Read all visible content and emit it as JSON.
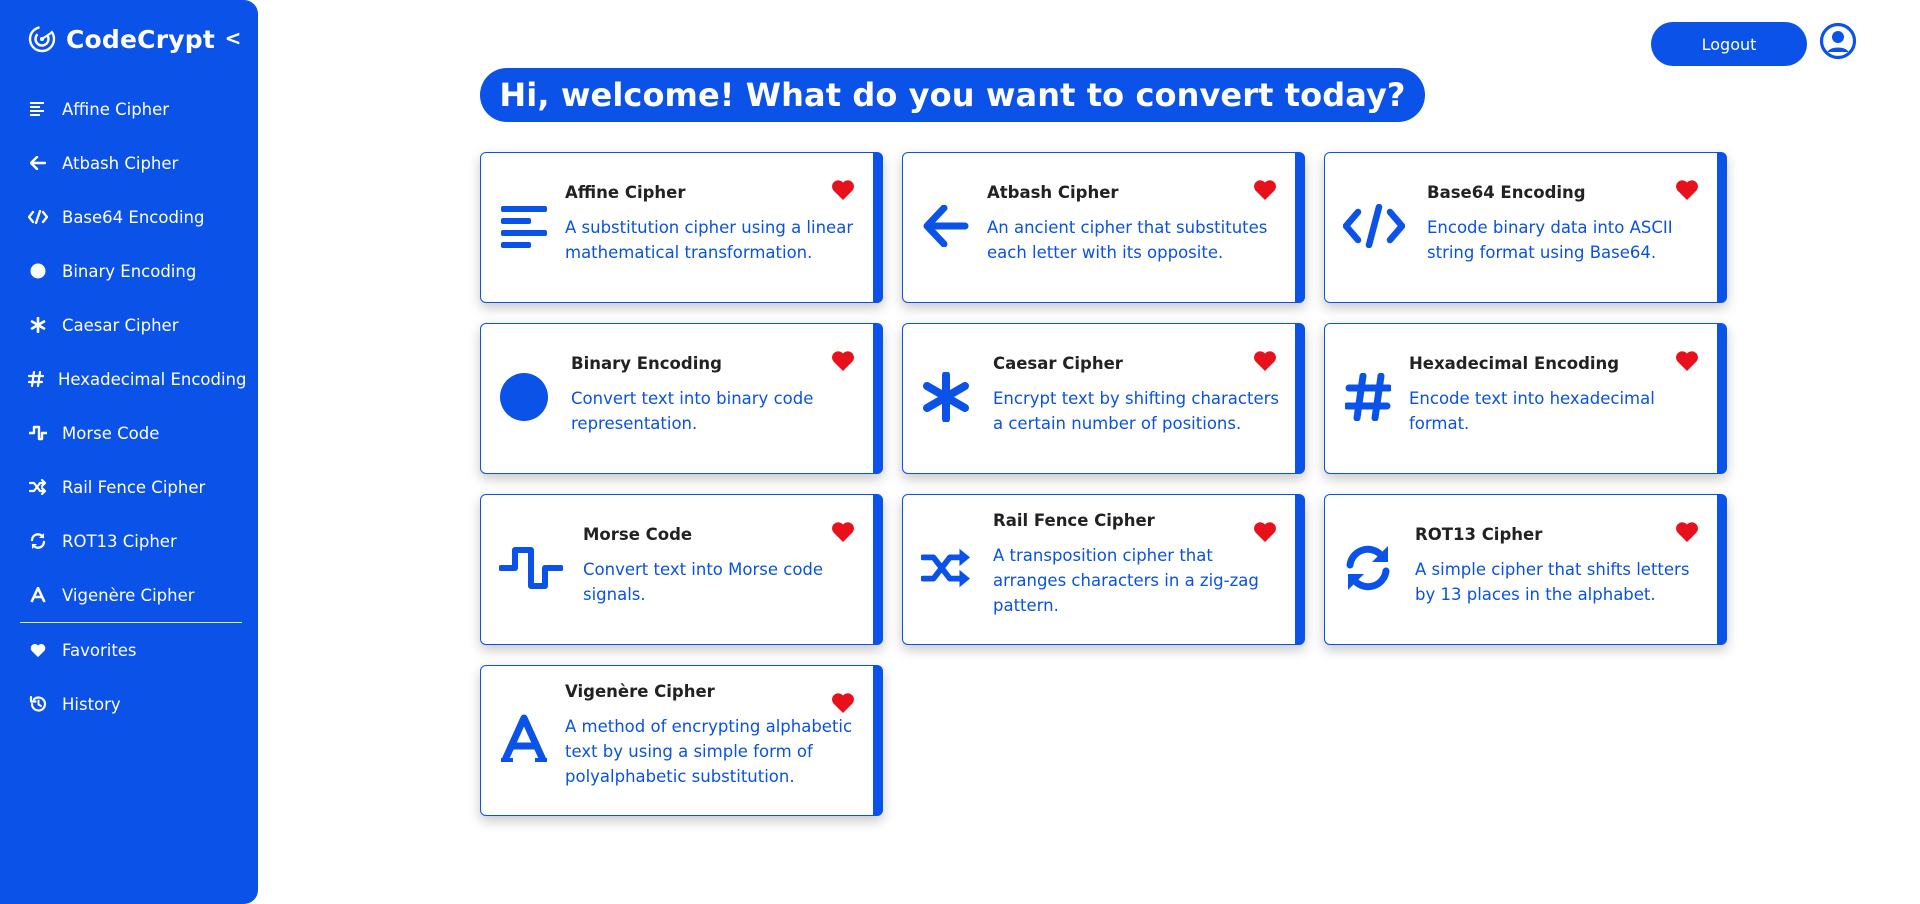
{
  "app": {
    "name": "CodeCrypt",
    "collapse_label": "<"
  },
  "colors": {
    "primary": "#0a52e8",
    "favorite": "#e8101a",
    "title_text": "#222222"
  },
  "sidebar": {
    "items": [
      {
        "label": "Affine Cipher",
        "icon": "align-left-icon"
      },
      {
        "label": "Atbash Cipher",
        "icon": "arrow-left-icon"
      },
      {
        "label": "Base64 Encoding",
        "icon": "code-icon"
      },
      {
        "label": "Binary Encoding",
        "icon": "circle-icon"
      },
      {
        "label": "Caesar Cipher",
        "icon": "asterisk-icon"
      },
      {
        "label": "Hexadecimal Encoding",
        "icon": "hashtag-icon"
      },
      {
        "label": "Morse Code",
        "icon": "wave-square-icon"
      },
      {
        "label": "Rail Fence Cipher",
        "icon": "shuffle-icon"
      },
      {
        "label": "ROT13 Cipher",
        "icon": "sync-icon"
      },
      {
        "label": "Vigenère Cipher",
        "icon": "letter-a-icon"
      }
    ],
    "secondary": [
      {
        "label": "Favorites",
        "icon": "heart-icon"
      },
      {
        "label": "History",
        "icon": "history-icon"
      }
    ]
  },
  "header": {
    "logout_label": "Logout",
    "avatar_icon": "user-circle-icon"
  },
  "welcome": {
    "text": "Hi, welcome! What do you want to convert today?"
  },
  "cards": [
    {
      "title": "Affine Cipher",
      "description": "A substitution cipher using a linear mathematical transformation.",
      "icon": "align-left-icon",
      "favorite": true
    },
    {
      "title": "Atbash Cipher",
      "description": "An ancient cipher that substitutes each letter with its opposite.",
      "icon": "arrow-left-icon",
      "favorite": true
    },
    {
      "title": "Base64 Encoding",
      "description": "Encode binary data into ASCII string format using Base64.",
      "icon": "code-icon",
      "favorite": true
    },
    {
      "title": "Binary Encoding",
      "description": "Convert text into binary code representation.",
      "icon": "circle-icon",
      "favorite": true
    },
    {
      "title": "Caesar Cipher",
      "description": "Encrypt text by shifting characters a certain number of positions.",
      "icon": "asterisk-icon",
      "favorite": true
    },
    {
      "title": "Hexadecimal Encoding",
      "description": "Encode text into hexadecimal format.",
      "icon": "hashtag-icon",
      "favorite": true
    },
    {
      "title": "Morse Code",
      "description": "Convert text into Morse code signals.",
      "icon": "wave-square-icon",
      "favorite": true
    },
    {
      "title": "Rail Fence Cipher",
      "description": "A transposition cipher that arranges characters in a zig-zag pattern.",
      "icon": "shuffle-icon",
      "favorite": true
    },
    {
      "title": "ROT13 Cipher",
      "description": "A simple cipher that shifts letters by 13 places in the alphabet.",
      "icon": "sync-icon",
      "favorite": true
    },
    {
      "title": "Vigenère Cipher",
      "description": "A method of encrypting alphabetic text by using a simple form of polyalphabetic substitution.",
      "icon": "letter-a-icon",
      "favorite": true
    }
  ]
}
